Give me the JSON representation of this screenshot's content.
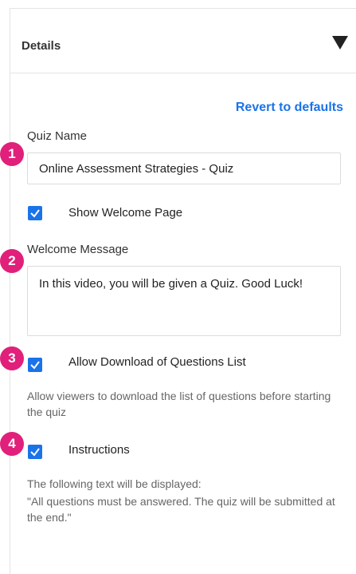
{
  "header": {
    "title": "Details",
    "toggle_icon": "triangle-down-icon"
  },
  "revert_link": "Revert to defaults",
  "quiz_name": {
    "label": "Quiz Name",
    "value": "Online Assessment Strategies - Quiz"
  },
  "welcome_page": {
    "label": "Show Welcome Page",
    "checked": true
  },
  "welcome_message": {
    "label": "Welcome Message",
    "value": "In this video, you will be given a Quiz. Good Luck!"
  },
  "download_questions": {
    "label": "Allow Download of Questions List",
    "checked": true,
    "help": "Allow viewers to download the list of questions before starting the quiz"
  },
  "instructions": {
    "label": "Instructions",
    "checked": true,
    "help_line1": "The following text will be displayed:",
    "help_line2": "\"All questions must be answered. The quiz will be submitted at the end.\""
  },
  "markers": [
    "1",
    "2",
    "3",
    "4"
  ],
  "colors": {
    "accent": "#1a73e8",
    "marker": "#e0207a"
  }
}
